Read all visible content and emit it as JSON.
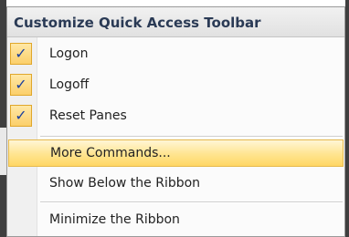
{
  "menu": {
    "title": "Customize Quick Access Toolbar",
    "items": [
      {
        "label": "Logon",
        "checked": true
      },
      {
        "label": "Logoff",
        "checked": true
      },
      {
        "label": "Reset Panes",
        "checked": true
      },
      {
        "label": "More Commands...",
        "highlighted": true
      },
      {
        "label": "Show Below the Ribbon"
      },
      {
        "label": "Minimize the Ribbon"
      }
    ],
    "check_glyph": "✓",
    "colors": {
      "highlight": "#ffe48f",
      "check_background": "#fbcf6a",
      "title_text": "#2a3a55"
    }
  }
}
